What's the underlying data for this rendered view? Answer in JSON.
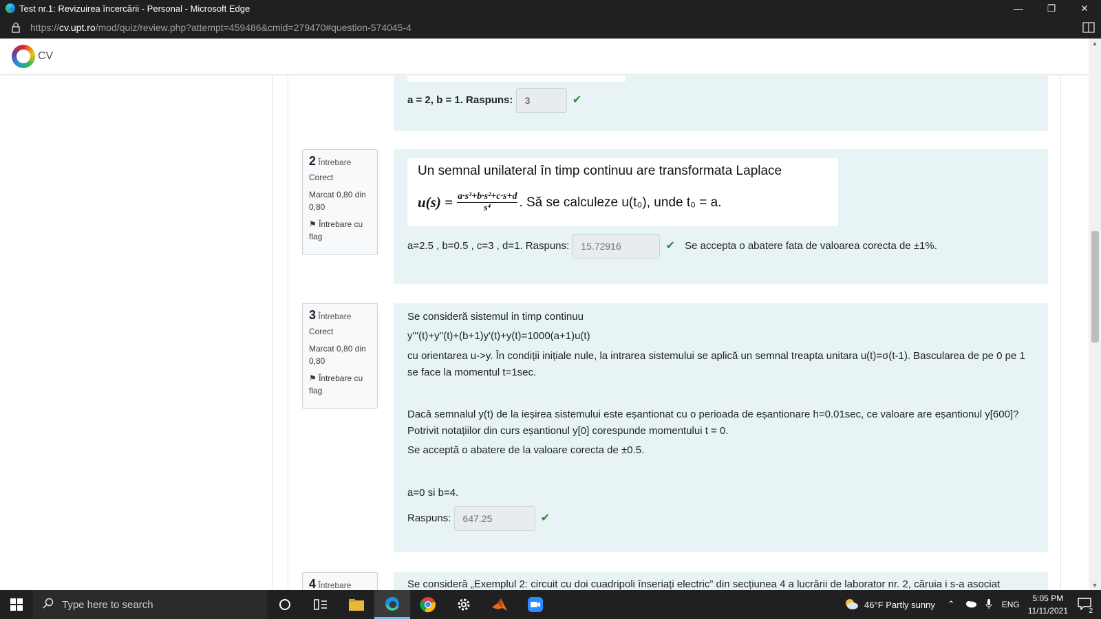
{
  "window": {
    "title": "Test nr.1: Revizuirea încercării - Personal - Microsoft Edge",
    "url_domain": "cv.upt.ro",
    "url_rest": "/mod/quiz/review.php?attempt=459486&cmid=279470#question-574045-4",
    "url_scheme": "https://"
  },
  "site": {
    "logo_text": "CV"
  },
  "q1": {
    "prompt": "a = 2, b = 1. Raspuns:",
    "answer": "3"
  },
  "q2": {
    "number": "2",
    "word": "Întrebare",
    "state": "Corect",
    "grade": "Marcat 0,80 din 0,80",
    "flag": "Întrebare cu flag",
    "heading": "Un semnal unilateral în timp continuu are transformata Laplace",
    "formula_lhs": "u(s) =",
    "formula_num": "a·s³+b·s²+c·s+d",
    "formula_den": "s⁴",
    "formula_rest": ". Să se calculeze u(t₀), unde t₀ = a.",
    "params": "a=2.5 , b=0.5 , c=3 , d=1. Raspuns:",
    "answer": "15.72916",
    "tolerance": "Se accepta o abatere fata de valoarea corecta de ±1%."
  },
  "q3": {
    "number": "3",
    "word": "Întrebare",
    "state": "Corect",
    "grade": "Marcat 0,80 din 0,80",
    "flag": "Întrebare cu flag",
    "line1": "Se consideră sistemul in timp continuu",
    "line2": "y'''(t)+y''(t)+(b+1)y'(t)+y(t)=1000(a+1)u(t)",
    "line3": "cu orientarea u->y. În condiții inițiale nule, la intrarea sistemului se aplică un semnal treapta unitara u(t)=σ(t-1). Bascularea de pe 0 pe 1 se face la momentul t=1sec.",
    "line4": "Dacă semnalul y(t) de la ieșirea sistemului este eșantionat cu o perioada de eșantionare h=0.01sec, ce valoare are eșantionul y[600]?  Potrivit notațiilor din curs eșantionul y[0] corespunde momentului t = 0.",
    "line5": "Se acceptă o abatere de la valoare corecta de ±0.5.",
    "params": "a=0 si b=4.",
    "answer_label": "Raspuns:",
    "answer": "647.25"
  },
  "q4": {
    "number": "4",
    "word": "Întrebare",
    "text": "Se consideră „Exemplul 2: circuit cu doi cuadripoli înseriați electric” din secțiunea 4 a lucrării de laborator nr. 2, căruia i s-a asociat"
  },
  "taskbar": {
    "search_placeholder": "Type here to search",
    "weather": "46°F  Partly sunny",
    "lang": "ENG",
    "time": "5:05 PM",
    "date": "11/11/2021",
    "notifications": "2"
  }
}
